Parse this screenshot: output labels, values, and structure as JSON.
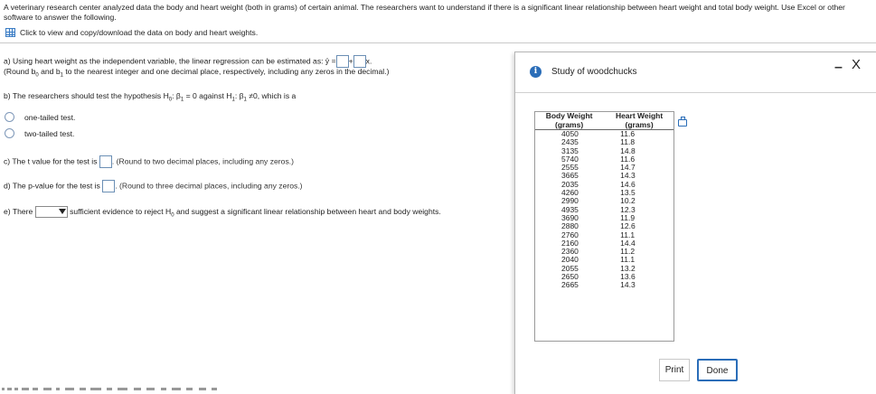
{
  "intro": "A veterinary research center analyzed data the body and heart weight (both in grams) of certain animal. The researchers want to understand if there is a significant linear relationship between heart weight and total body weight. Use Excel or other software to answer the following.",
  "data_link": "Click to view and copy/download the data on body and heart weights.",
  "qa": {
    "prefix": "a) Using heart weight as the independent variable, the linear regression can be estimated as: ",
    "yhat": "ŷ",
    "eq": "=",
    "plus": "+",
    "x": "x.",
    "round_a": "(Round b",
    "b0_sub": "0",
    "and_b": " and b",
    "b1_sub": "1",
    "round_tail": " to the nearest integer and one decimal place, respectively, including any zeros in the decimal.)"
  },
  "qb": {
    "prefix": "b) The researchers should test the hypothesis H",
    "h0_sub": "0",
    "mid1": ": β",
    "b1_sub": "1",
    "mid2": " = 0 against H",
    "h1_sub": "1",
    "mid3": ": β",
    "b1_sub2": "1",
    "tail": " ≠0, which is a",
    "options": [
      "one-tailed test.",
      "two-tailed test."
    ]
  },
  "qc": {
    "prefix": "c) The t value for the test is",
    "hint": ". (Round to two decimal places, including any zeros.)"
  },
  "qd": {
    "prefix": "d) The p-value for the test is",
    "hint": ". (Round to three decimal places, including any zeros.)"
  },
  "qe": {
    "prefix": "e) There",
    "mid": "sufficient evidence to reject H",
    "sub": "0",
    "tail": " and suggest a significant linear relationship between heart and body weights."
  },
  "modal": {
    "title": "Study of woodchucks",
    "col1_l1": "Body Weight",
    "col1_l2": "(grams)",
    "col2_l1": "Heart Weight",
    "col2_l2": "(grams)",
    "rows": [
      [
        "4050",
        "11.6"
      ],
      [
        "2435",
        "11.8"
      ],
      [
        "3135",
        "14.8"
      ],
      [
        "5740",
        "11.6"
      ],
      [
        "2555",
        "14.7"
      ],
      [
        "3665",
        "14.3"
      ],
      [
        "2035",
        "14.6"
      ],
      [
        "4260",
        "13.5"
      ],
      [
        "2990",
        "10.2"
      ],
      [
        "4935",
        "12.3"
      ],
      [
        "3690",
        "11.9"
      ],
      [
        "2880",
        "12.6"
      ],
      [
        "2760",
        "11.1"
      ],
      [
        "2160",
        "14.4"
      ],
      [
        "2360",
        "11.2"
      ],
      [
        "2040",
        "11.1"
      ],
      [
        "2055",
        "13.2"
      ],
      [
        "2650",
        "13.6"
      ],
      [
        "2665",
        "14.3"
      ]
    ],
    "print": "Print",
    "done": "Done",
    "minimize": "–",
    "close": "X"
  }
}
